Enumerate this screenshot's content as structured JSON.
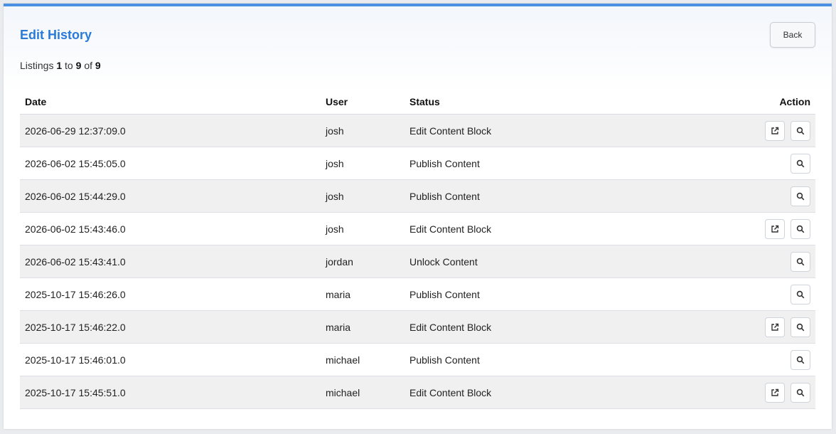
{
  "header": {
    "title": "Edit History",
    "back_label": "Back"
  },
  "listing": {
    "prefix": "Listings",
    "from": "1",
    "to_word": "to",
    "to": "9",
    "of_word": "of",
    "total": "9"
  },
  "table": {
    "headers": {
      "date": "Date",
      "user": "User",
      "status": "Status",
      "action": "Action"
    },
    "rows": [
      {
        "date": "2026-06-29 12:37:09.0",
        "user": "josh",
        "status": "Edit Content Block",
        "open": true
      },
      {
        "date": "2026-06-02 15:45:05.0",
        "user": "josh",
        "status": "Publish Content",
        "open": false
      },
      {
        "date": "2026-06-02 15:44:29.0",
        "user": "josh",
        "status": "Publish Content",
        "open": false
      },
      {
        "date": "2026-06-02 15:43:46.0",
        "user": "josh",
        "status": "Edit Content Block",
        "open": true
      },
      {
        "date": "2026-06-02 15:43:41.0",
        "user": "jordan",
        "status": "Unlock Content",
        "open": false
      },
      {
        "date": "2025-10-17 15:46:26.0",
        "user": "maria",
        "status": "Publish Content",
        "open": false
      },
      {
        "date": "2025-10-17 15:46:22.0",
        "user": "maria",
        "status": "Edit Content Block",
        "open": true
      },
      {
        "date": "2025-10-17 15:46:01.0",
        "user": "michael",
        "status": "Publish Content",
        "open": false
      },
      {
        "date": "2025-10-17 15:45:51.0",
        "user": "michael",
        "status": "Edit Content Block",
        "open": true
      }
    ]
  },
  "icons": {
    "open": "external-link-icon",
    "view": "search-icon"
  },
  "colors": {
    "accent": "#2a7ad8",
    "top_bar": "#4a90e2",
    "row_stripe": "#f0f0f0"
  }
}
